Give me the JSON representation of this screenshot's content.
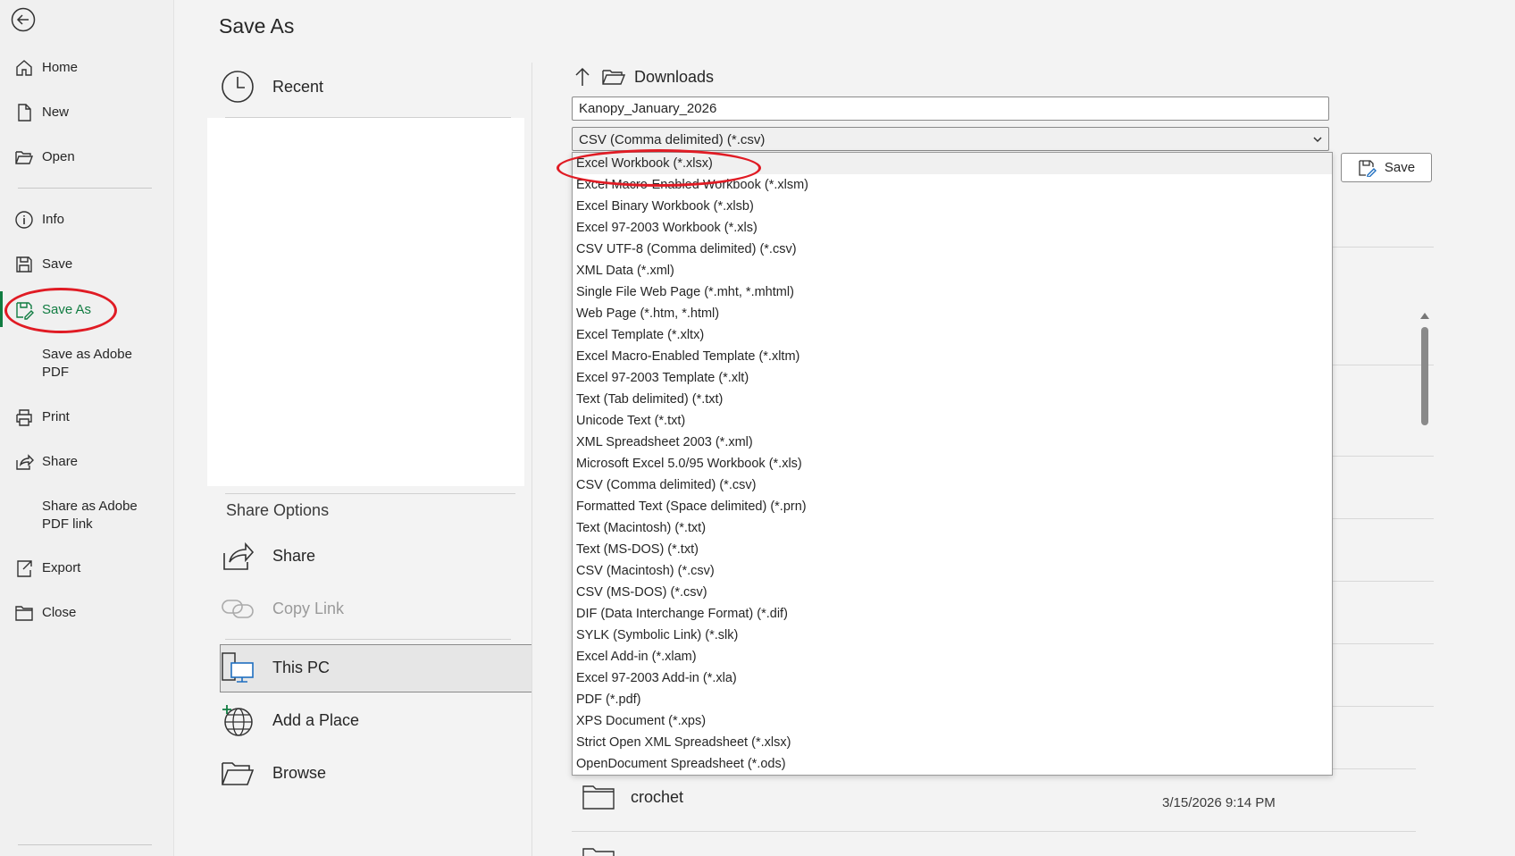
{
  "nav": {
    "home": "Home",
    "new": "New",
    "open": "Open",
    "info": "Info",
    "save": "Save",
    "save_as": "Save As",
    "save_adobe_1": "Save as Adobe",
    "save_adobe_2": "PDF",
    "print": "Print",
    "share": "Share",
    "share_adobe_1": "Share as Adobe",
    "share_adobe_2": "PDF link",
    "export": "Export",
    "close": "Close"
  },
  "page_title": "Save As",
  "locations": {
    "recent": "Recent",
    "share_options": "Share Options",
    "share": "Share",
    "copy_link": "Copy Link",
    "this_pc": "This PC",
    "add_place": "Add a Place",
    "browse": "Browse"
  },
  "location_path": "Downloads",
  "file_name": "Kanopy_January_2026",
  "file_type": "CSV (Comma delimited) (*.csv)",
  "save_button": "Save",
  "file_type_options": [
    "Excel Workbook (*.xlsx)",
    "Excel Macro-Enabled Workbook (*.xlsm)",
    "Excel Binary Workbook (*.xlsb)",
    "Excel 97-2003 Workbook (*.xls)",
    "CSV UTF-8 (Comma delimited) (*.csv)",
    "XML Data (*.xml)",
    "Single File Web Page (*.mht, *.mhtml)",
    "Web Page (*.htm, *.html)",
    "Excel Template (*.xltx)",
    "Excel Macro-Enabled Template (*.xltm)",
    "Excel 97-2003 Template (*.xlt)",
    "Text (Tab delimited) (*.txt)",
    "Unicode Text (*.txt)",
    "XML Spreadsheet 2003 (*.xml)",
    "Microsoft Excel 5.0/95 Workbook (*.xls)",
    "CSV (Comma delimited) (*.csv)",
    "Formatted Text (Space delimited) (*.prn)",
    "Text (Macintosh) (*.txt)",
    "Text (MS-DOS) (*.txt)",
    "CSV (Macintosh) (*.csv)",
    "CSV (MS-DOS) (*.csv)",
    "DIF (Data Interchange Format) (*.dif)",
    "SYLK (Symbolic Link) (*.slk)",
    "Excel Add-in (*.xlam)",
    "Excel 97-2003 Add-in (*.xla)",
    "PDF (*.pdf)",
    "XPS Document (*.xps)",
    "Strict Open XML Spreadsheet (*.xlsx)",
    "OpenDocument Spreadsheet (*.ods)"
  ],
  "folders": [
    {
      "name": "crochet",
      "modified": "3/15/2026 9:14 PM"
    }
  ],
  "colors": {
    "accent": "#107c41",
    "annotation": "#e01b24"
  }
}
